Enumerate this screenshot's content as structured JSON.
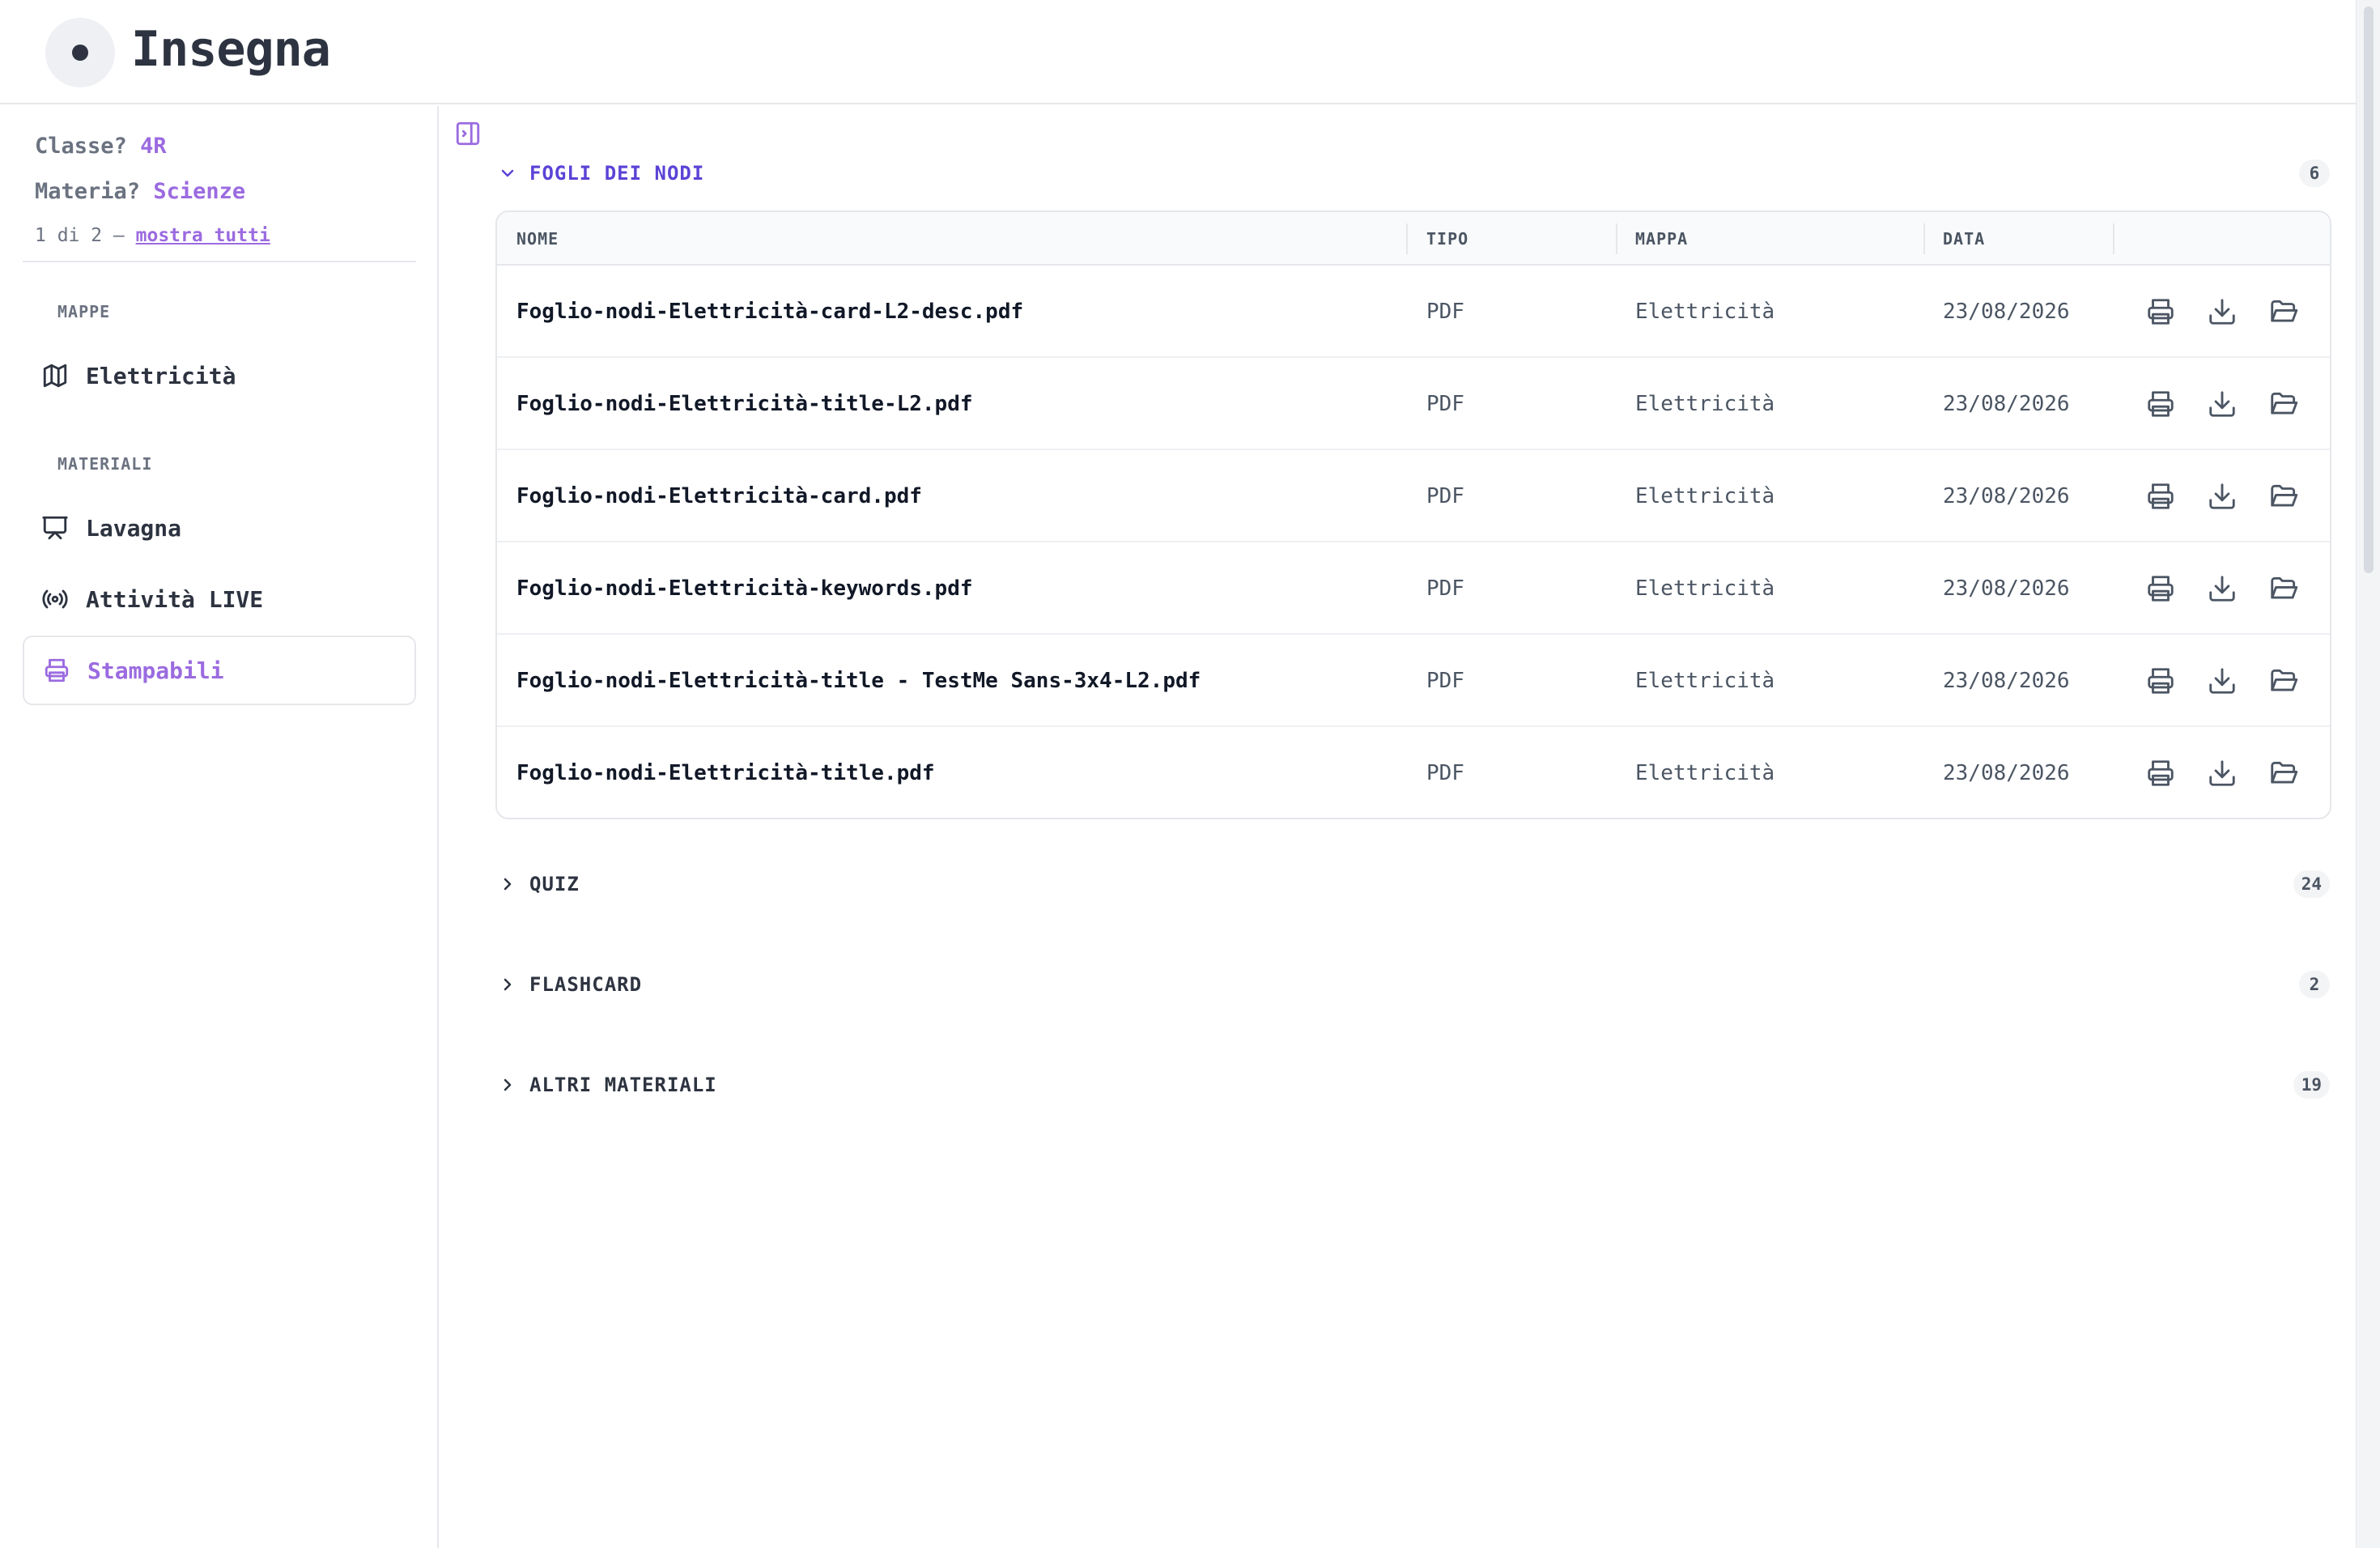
{
  "header": {
    "title": "Insegna"
  },
  "sidebar": {
    "class_label": "Classe?",
    "class_value": "4R",
    "subject_label": "Materia?",
    "subject_value": "Scienze",
    "count_text": "1 di 2 —",
    "show_all_link": "mostra tutti",
    "sections": {
      "maps": "MAPPE",
      "materials": "MATERIALI"
    },
    "map_items": [
      {
        "label": "Elettricità",
        "icon": "map-icon"
      }
    ],
    "material_items": [
      {
        "label": "Lavagna",
        "icon": "presentation-icon"
      },
      {
        "label": "Attività LIVE",
        "icon": "broadcast-icon"
      },
      {
        "label": "Stampabili",
        "icon": "printer-icon",
        "active": true
      }
    ]
  },
  "main": {
    "sections": [
      {
        "title": "FOGLI DEI NODI",
        "count": "6",
        "expanded": true
      },
      {
        "title": "QUIZ",
        "count": "24",
        "expanded": false
      },
      {
        "title": "FLASHCARD",
        "count": "2",
        "expanded": false
      },
      {
        "title": "ALTRI MATERIALI",
        "count": "19",
        "expanded": false
      }
    ],
    "table": {
      "columns": [
        "NOME",
        "TIPO",
        "MAPPA",
        "DATA"
      ],
      "rows": [
        {
          "name": "Foglio-nodi-Elettricità-card-L2-desc.pdf",
          "type": "PDF",
          "map": "Elettricità",
          "date": "23/08/2026"
        },
        {
          "name": "Foglio-nodi-Elettricità-title-L2.pdf",
          "type": "PDF",
          "map": "Elettricità",
          "date": "23/08/2026"
        },
        {
          "name": "Foglio-nodi-Elettricità-card.pdf",
          "type": "PDF",
          "map": "Elettricità",
          "date": "23/08/2026"
        },
        {
          "name": "Foglio-nodi-Elettricità-keywords.pdf",
          "type": "PDF",
          "map": "Elettricità",
          "date": "23/08/2026"
        },
        {
          "name": "Foglio-nodi-Elettricità-title - TestMe Sans-3x4-L2.pdf",
          "type": "PDF",
          "map": "Elettricità",
          "date": "23/08/2026"
        },
        {
          "name": "Foglio-nodi-Elettricità-title.pdf",
          "type": "PDF",
          "map": "Elettricità",
          "date": "23/08/2026"
        }
      ],
      "row_actions": [
        "printer-icon",
        "download-icon",
        "folder-open-icon"
      ]
    }
  },
  "colors": {
    "accent": "#9b6be0",
    "section_open": "#5b43d6",
    "text_dark": "#2d3340",
    "border": "#e5e7eb"
  }
}
